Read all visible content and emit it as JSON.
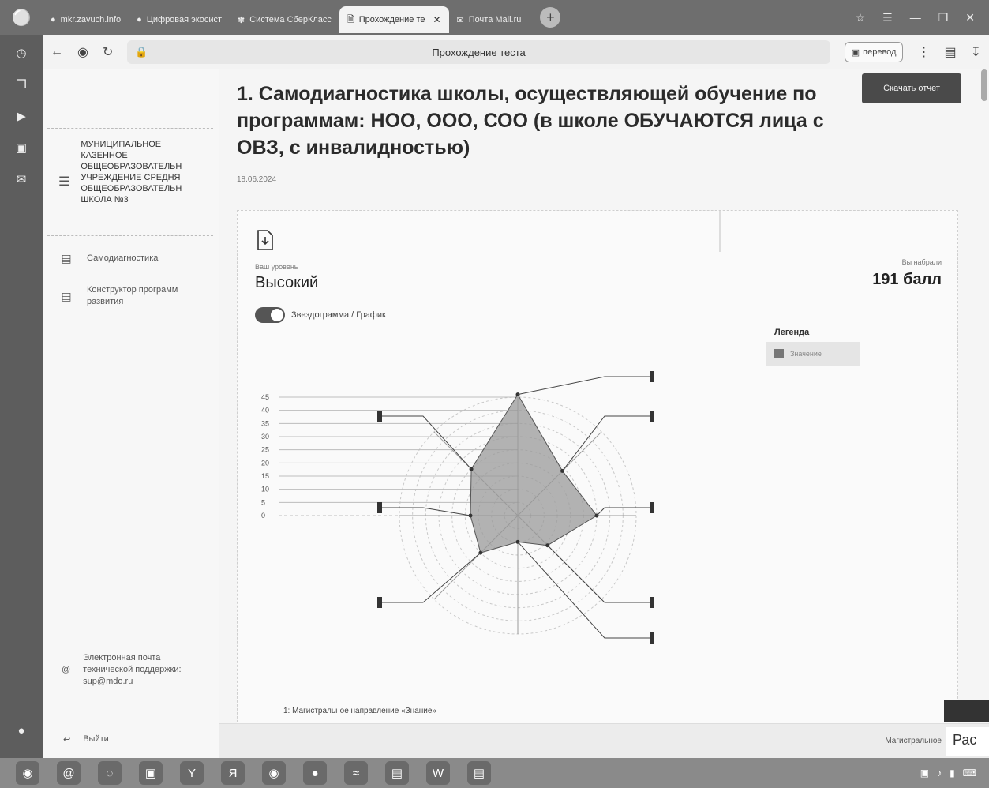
{
  "browser": {
    "tabs": [
      {
        "label": "mkr.zavuch.info",
        "icon": "globe-icon",
        "active": false
      },
      {
        "label": "Цифровая экосист",
        "icon": "globe-icon",
        "active": false
      },
      {
        "label": "Система СберКласс",
        "icon": "globe-icon",
        "active": false
      },
      {
        "label": "Прохождение те",
        "icon": "document-icon",
        "active": true
      },
      {
        "label": "Почта Mail.ru",
        "icon": "mail-icon",
        "active": false
      }
    ],
    "page_title": "Прохождение теста",
    "url": "",
    "translate_label": "перевод",
    "add_tab": "+"
  },
  "sidebar": {
    "school_name": [
      "МУНИЦИПАЛЬНОЕ",
      "КАЗЕННОЕ",
      "ОБЩЕОБРАЗОВАТЕЛЬН",
      "УЧРЕЖДЕНИЕ СРЕДНЯ",
      "ОБЩЕОБРАЗОВАТЕЛЬН",
      "ШКОЛА №3"
    ],
    "items": [
      {
        "label": "Самодиагностика"
      },
      {
        "label": "Конструктор программ развития"
      }
    ],
    "support": "Электронная почта технической поддержки: sup@mdo.ru",
    "logout": "Выйти"
  },
  "main": {
    "title": "1. Самодиагностика школы, осуществляющей обучение по программам: НОО, ООО, СОО (в школе ОБУЧАЮТСЯ лица с ОВЗ, с инвалидностью)",
    "date": "18.06.2024",
    "download_button": "Скачать отчет",
    "level_caption": "Ваш уровень",
    "level_value": "Высокий",
    "score_caption": "Вы набрали",
    "score_value": "191 балл",
    "toggle_label": "Звездограмма / График",
    "legend_title": "Легенда",
    "legend_item": "Значение",
    "direction": "1: Магистральное направление «Знание»"
  },
  "bottom": {
    "magistral_label": "Магистральное",
    "cut_label": "Рас"
  },
  "chart_data": {
    "type": "radar",
    "axes": 8,
    "scale_ticks": [
      0,
      5,
      10,
      15,
      20,
      25,
      30,
      35,
      40,
      45
    ],
    "series": [
      {
        "values": [
          46,
          24,
          30,
          16,
          10,
          20,
          18,
          25
        ]
      }
    ],
    "fill_color": "#9a9a9a",
    "grid": true
  },
  "colors": {
    "accent": "#4a4a4a",
    "tabbar": "#6e6e6e",
    "sidebar": "#5d5d5d"
  }
}
